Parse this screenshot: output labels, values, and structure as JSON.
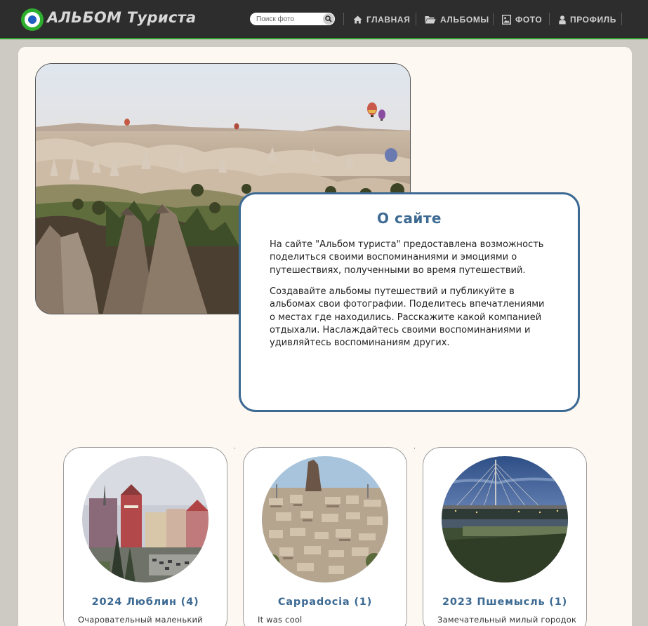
{
  "site": {
    "logo_text": "АЛЬБОМ Туриста"
  },
  "search": {
    "placeholder": "Поиск фото"
  },
  "nav": [
    {
      "label": "ГЛАВНАЯ",
      "icon": "home-icon"
    },
    {
      "label": "АЛЬБОМЫ",
      "icon": "folder-icon"
    },
    {
      "label": "ФОТО",
      "icon": "image-icon"
    },
    {
      "label": "ПРОФИЛЬ",
      "icon": "user-icon"
    }
  ],
  "about": {
    "title": "О сайте",
    "paragraph1": "На сайте \"Альбом туриста\" предоставлена возможность поделиться своими воспоминаниями и эмоциями о путешествиях, полученными во время путешествий.",
    "paragraph2": "Создавайте альбомы путешествий и публикуйте в альбомах свои фотографии. Поделитесь впечатлениями о местах где находились. Расскажите какой компанией отдыхали. Наслаждайтесь своими воспоминаниями и удивляйтесь воспоминаниям других."
  },
  "albums": [
    {
      "title": "2024 Люблин (4)",
      "description": "Очаровательный маленький"
    },
    {
      "title": "Cappadocia (1)",
      "description": "It was cool"
    },
    {
      "title": "2023 Пшемысль (1)",
      "description": "Замечательный милый городок"
    }
  ],
  "colors": {
    "accent": "#3d6a93",
    "header_bg": "#2d2d2d",
    "brand_green": "#2eae2e",
    "panel_bg": "#fdf8f2"
  }
}
